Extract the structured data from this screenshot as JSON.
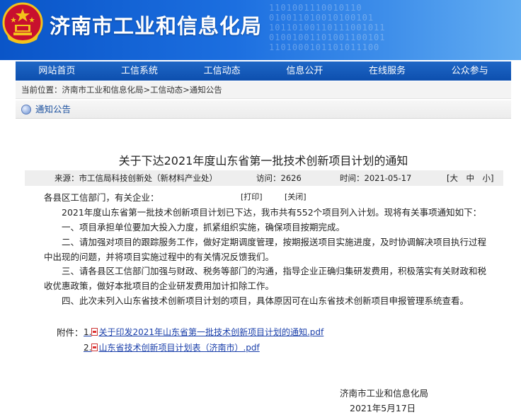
{
  "header": {
    "site_title": "济南市工业和信息化局",
    "binary_text": "1101001110010110\n010011010010100101\n10110100110111001011\n01001001101001100101\n1101000101101011100"
  },
  "nav": {
    "items": [
      "网站首页",
      "工信系统",
      "工信动态",
      "信息公开",
      "在线服务",
      "公众参与"
    ]
  },
  "breadcrumb": {
    "prefix": "当前位置：",
    "path": "济南市工业和信息化局>工信动态>通知公告"
  },
  "section": {
    "label": "通知公告"
  },
  "article": {
    "title": "关于下达2021年度山东省第一批技术创新项目计划的通知",
    "source": "来源：市工信局科技创新处（新材料产业处）",
    "visits": "访问：2626",
    "date": "时间：2021-05-17",
    "font_size_label": "[大　中　小]",
    "print": "[打印]",
    "close": "[关闭]",
    "salutation": "各县区工信部门，有关企业：",
    "paragraphs": [
      "　　2021年度山东省第一批技术创新项目计划已下达，我市共有552个项目列入计划。现将有关事项通知如下：",
      "　　一、项目承担单位要加大投入力度，抓紧组织实施，确保项目按期完成。",
      "　　二、请加强对项目的跟踪服务工作，做好定期调度管理，按期报送项目实施进度，及时协调解决项目执行过程中出现的问题，并将项目实施过程中的有关情况反馈我们。",
      "　　三、请各县区工信部门加强与财政、税务等部门的沟通，指导企业正确归集研发费用，积极落实有关财政和税收优惠政策，做好本批项目的企业研发费用加计扣除工作。",
      "　　四、此次未列入山东省技术创新项目计划的项目，具体原因可在山东省技术创新项目申报管理系统查看。"
    ],
    "attachments_label": "附件：",
    "attachments": [
      {
        "num": "1.",
        "name": "关于印发2021年山东省第一批技术创新项目计划的通知.pdf"
      },
      {
        "num": "2.",
        "name": "山东省技术创新项目计划表（济南市）.pdf"
      }
    ],
    "signature_org": "济南市工业和信息化局",
    "signature_date": "2021年5月17日"
  },
  "colors": {
    "banner": "#0a55c8",
    "nav": "#0d4fae",
    "link": "#1a3faa"
  }
}
